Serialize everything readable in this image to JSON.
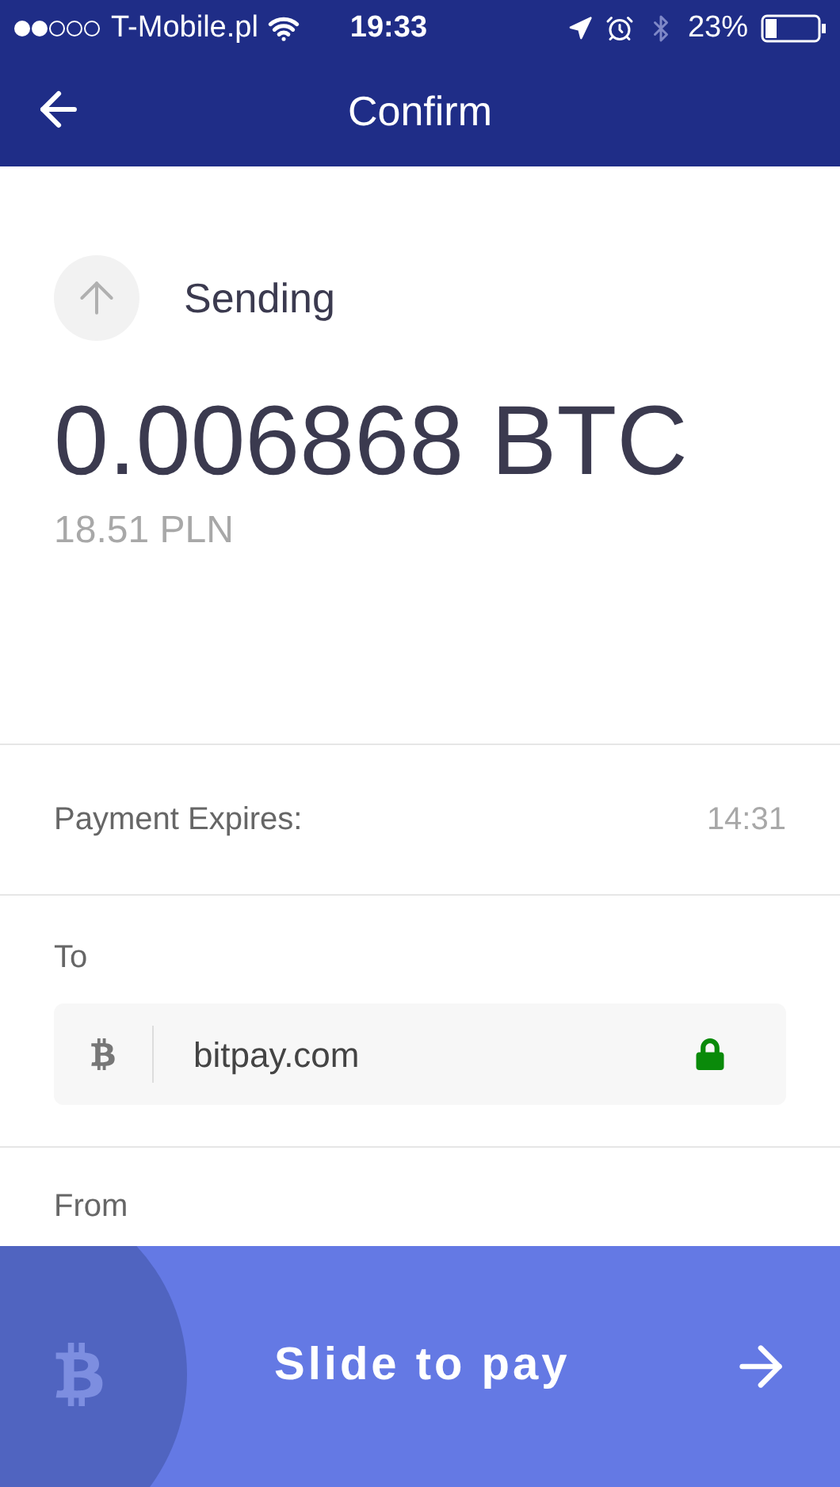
{
  "status_bar": {
    "carrier": "T-Mobile.pl",
    "time": "19:33",
    "battery": "23%"
  },
  "header": {
    "title": "Confirm"
  },
  "summary": {
    "label": "Sending",
    "amount": "0.006868",
    "unit": "BTC",
    "fiat": "18.51 PLN"
  },
  "expires": {
    "label": "Payment Expires:",
    "value": "14:31"
  },
  "to": {
    "label": "To",
    "value": "bitpay.com"
  },
  "from": {
    "label": "From"
  },
  "slider": {
    "label": "Slide to pay"
  }
}
